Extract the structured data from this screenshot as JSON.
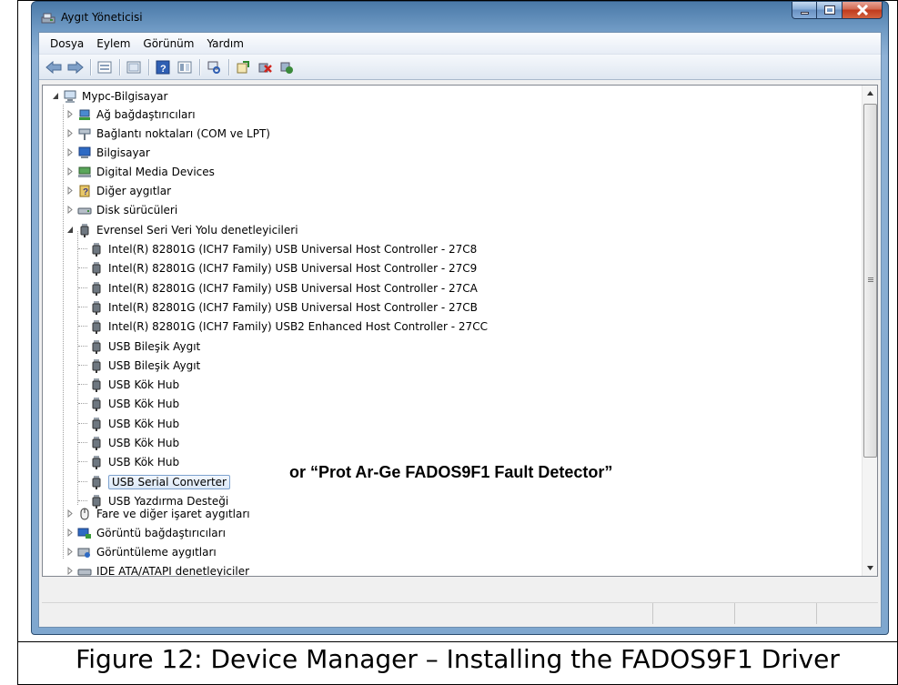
{
  "window": {
    "title": "Aygıt Yöneticisi"
  },
  "menu": [
    "Dosya",
    "Eylem",
    "Görünüm",
    "Yardım"
  ],
  "toolbar_icons": [
    "back-arrow-icon",
    "forward-arrow-icon",
    "properties-view-icon",
    "list-view-icon",
    "help-icon",
    "details-view-icon",
    "scan-hardware-icon",
    "update-driver-icon",
    "uninstall-icon",
    "disable-icon"
  ],
  "tree": {
    "root": "Mypc-Bilgisayar",
    "categories": [
      {
        "label": "Ağ bağdaştırıcıları",
        "icon": "network-adapter-icon"
      },
      {
        "label": "Bağlantı noktaları (COM ve LPT)",
        "icon": "port-icon"
      },
      {
        "label": "Bilgisayar",
        "icon": "computer-icon"
      },
      {
        "label": "Digital Media Devices",
        "icon": "media-device-icon"
      },
      {
        "label": "Diğer aygıtlar",
        "icon": "unknown-device-icon"
      },
      {
        "label": "Disk sürücüleri",
        "icon": "disk-drive-icon"
      },
      {
        "label": "Evrensel Seri Veri Yolu denetleyicileri",
        "icon": "usb-icon",
        "expanded": true
      }
    ],
    "usb_children": [
      "Intel(R) 82801G (ICH7 Family) USB Universal Host Controller - 27C8",
      "Intel(R) 82801G (ICH7 Family) USB Universal Host Controller - 27C9",
      "Intel(R) 82801G (ICH7 Family) USB Universal Host Controller - 27CA",
      "Intel(R) 82801G (ICH7 Family) USB Universal Host Controller - 27CB",
      "Intel(R) 82801G (ICH7 Family) USB2 Enhanced Host Controller - 27CC",
      "USB Bileşik Aygıt",
      "USB Bileşik Aygıt",
      "USB Kök Hub",
      "USB Kök Hub",
      "USB Kök Hub",
      "USB Kök Hub",
      "USB Kök Hub",
      "USB Serial Converter",
      "USB Yazdırma Desteği"
    ],
    "after_categories": [
      {
        "label": "Fare ve diğer işaret aygıtları",
        "icon": "mouse-icon"
      },
      {
        "label": "Görüntü bağdaştırıcıları",
        "icon": "display-adapter-icon"
      },
      {
        "label": "Görüntüleme aygıtları",
        "icon": "imaging-device-icon"
      },
      {
        "label": "IDE ATA/ATAPI denetleyiciler",
        "icon": "ide-controller-icon"
      }
    ]
  },
  "annotation": "or “Prot Ar-Ge FADOS9F1 Fault Detector”",
  "caption": "Figure 12: Device Manager – Installing the FADOS9F1 Driver",
  "colors": {
    "title_gradient_top": "#4a79a8",
    "close_button": "#c03a1c",
    "selection_border": "#7da2ce"
  }
}
